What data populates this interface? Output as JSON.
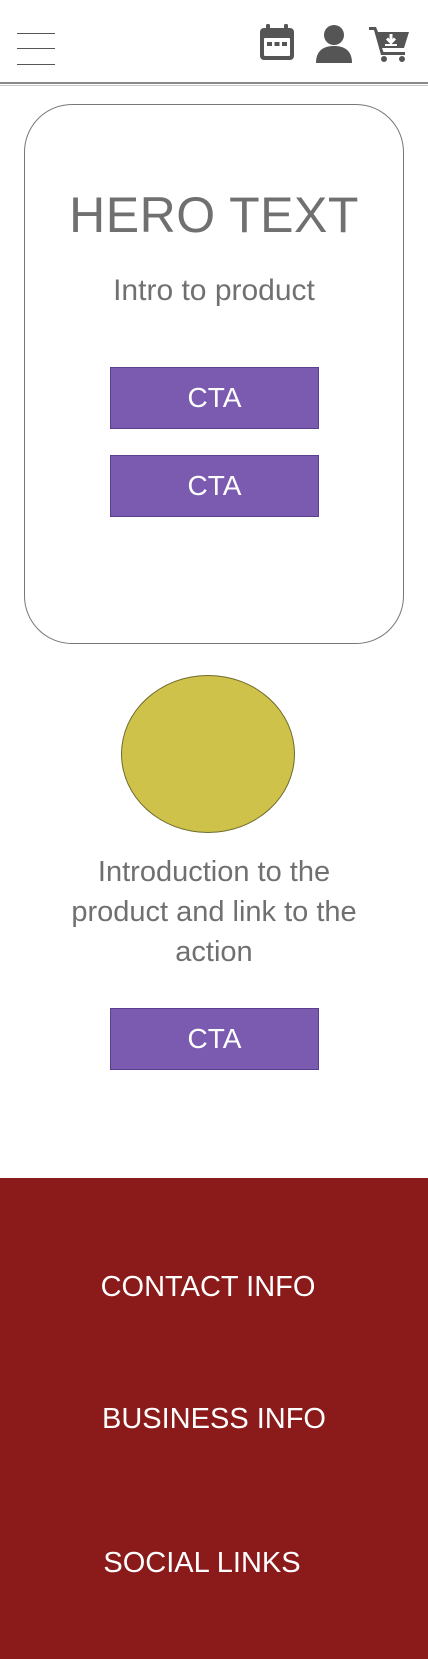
{
  "header": {
    "menu_icon": "hamburger-menu-icon",
    "icons": [
      "calendar-icon",
      "user-icon",
      "cart-download-icon"
    ]
  },
  "hero": {
    "title": "HERO TEXT",
    "subtitle": "Intro to product",
    "cta_primary": "CTA",
    "cta_secondary": "CTA"
  },
  "product": {
    "image_placeholder_color": "#cfc24a",
    "intro": "Introduction to the product and link to the action",
    "cta": "CTA"
  },
  "footer": {
    "background_color": "#8b1a1a",
    "contact": "CONTACT INFO",
    "business": "BUSINESS INFO",
    "social": "SOCIAL LINKS"
  },
  "colors": {
    "cta": "#7b5bb0",
    "text": "#707070",
    "footer_text": "#ffffff"
  }
}
